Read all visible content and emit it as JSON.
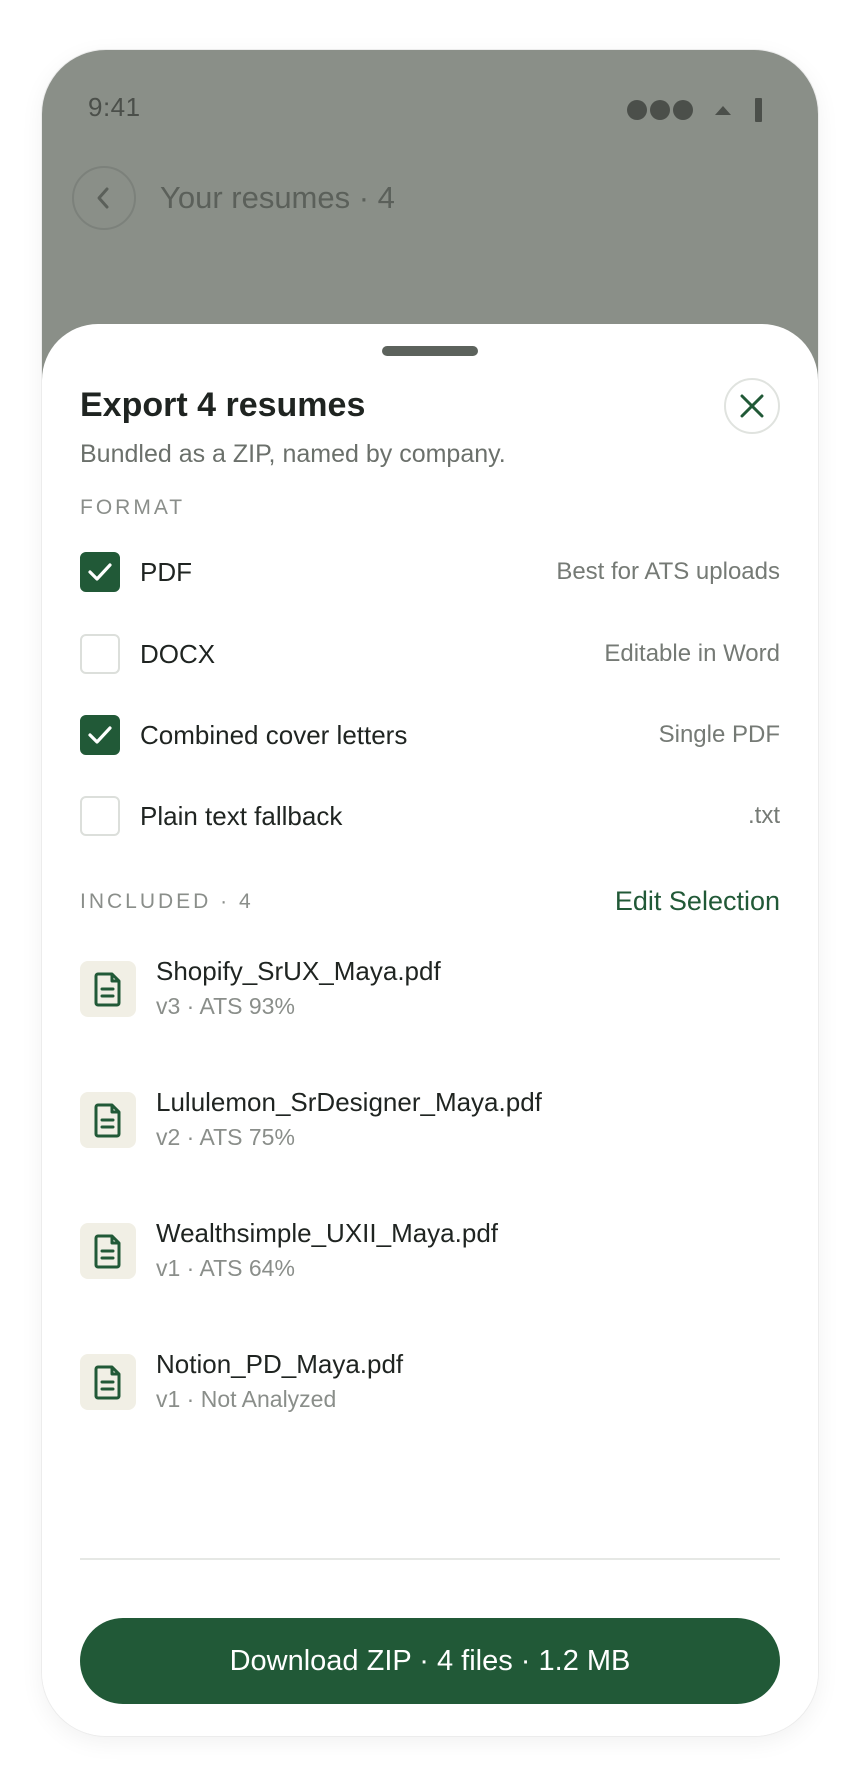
{
  "status_bar": {
    "time": "9:41"
  },
  "header": {
    "title": "Your resumes · 4"
  },
  "sheet": {
    "title": "Export 4 resumes",
    "subtitle": "Bundled as a ZIP, named by company.",
    "format_label": "FORMAT",
    "options": [
      {
        "label": "PDF",
        "hint": "Best for ATS uploads",
        "checked": true
      },
      {
        "label": "DOCX",
        "hint": "Editable in Word",
        "checked": false
      },
      {
        "label": "Combined cover letters",
        "hint": "Single PDF",
        "checked": true
      },
      {
        "label": "Plain text fallback",
        "hint": ".txt",
        "checked": false
      }
    ],
    "included_label": "INCLUDED · 4",
    "edit_selection": "Edit Selection",
    "files": [
      {
        "name": "Shopify_SrUX_Maya.pdf",
        "meta": "v3 · ATS 93%"
      },
      {
        "name": "Lululemon_SrDesigner_Maya.pdf",
        "meta": "v2 · ATS 75%"
      },
      {
        "name": "Wealthsimple_UXII_Maya.pdf",
        "meta": "v1 · ATS 64%"
      },
      {
        "name": "Notion_PD_Maya.pdf",
        "meta": "v1 · Not Analyzed"
      }
    ],
    "download_label": "Download ZIP · 4 files · 1.2 MB"
  },
  "colors": {
    "accent": "#215937",
    "backdrop": "#8a8f88",
    "file_icon_bg": "#f1efe5"
  }
}
